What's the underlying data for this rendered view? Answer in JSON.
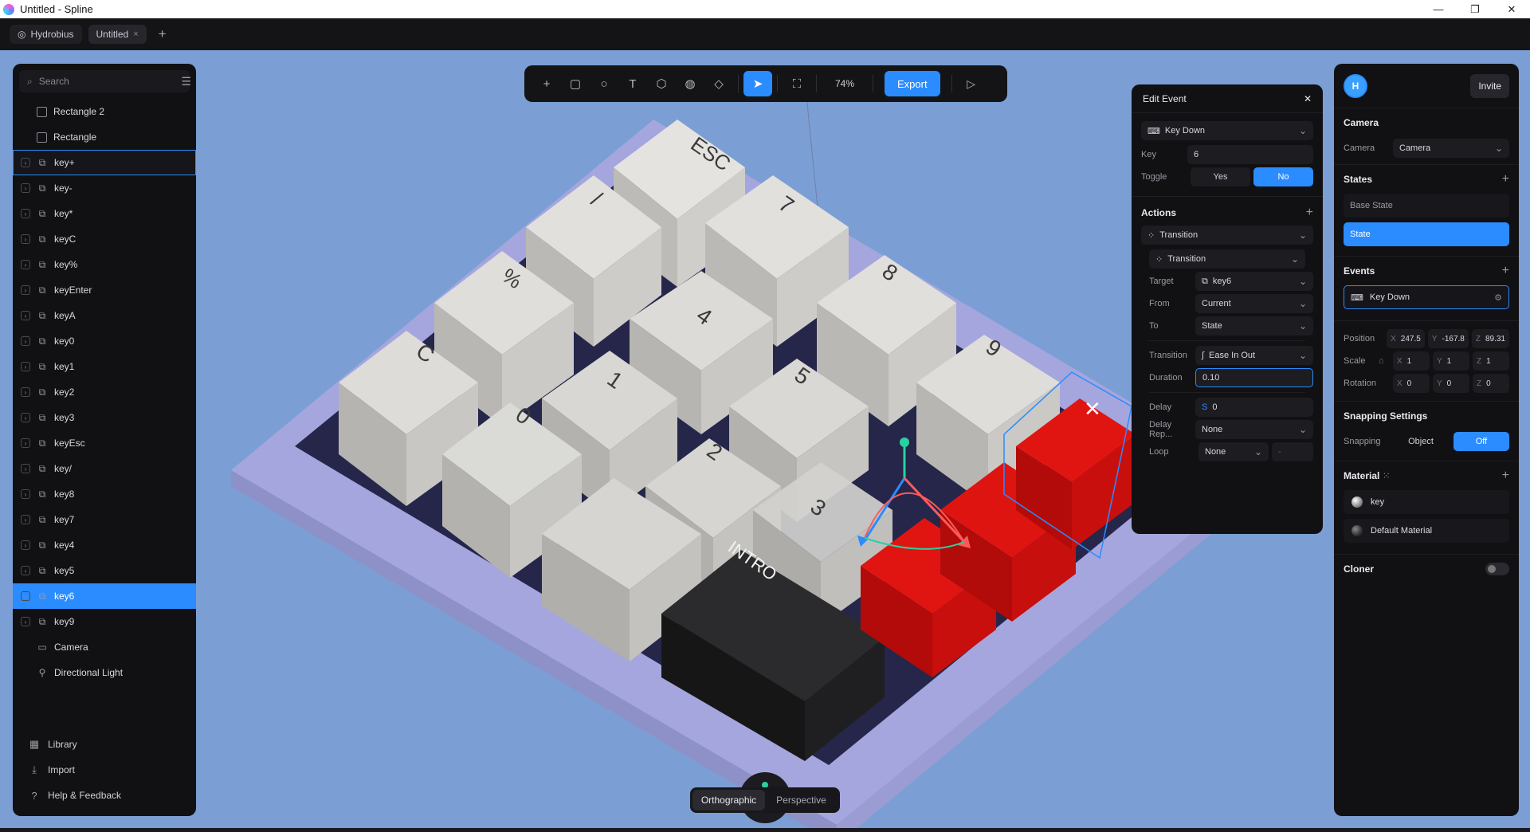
{
  "window": {
    "title": "Untitled - Spline",
    "minimize": "—",
    "maximize": "❐",
    "close": "✕"
  },
  "tabs": {
    "team": "Hydrobius",
    "file": "Untitled",
    "close": "×",
    "add": "+"
  },
  "sidebar": {
    "search_placeholder": "Search",
    "layers": [
      {
        "label": "Rectangle 2",
        "kind": "shape"
      },
      {
        "label": "Rectangle",
        "kind": "shape"
      },
      {
        "label": "key+",
        "kind": "group"
      },
      {
        "label": "key-",
        "kind": "group"
      },
      {
        "label": "key*",
        "kind": "group"
      },
      {
        "label": "keyC",
        "kind": "group"
      },
      {
        "label": "key%",
        "kind": "group"
      },
      {
        "label": "keyEnter",
        "kind": "group"
      },
      {
        "label": "keyA",
        "kind": "group"
      },
      {
        "label": "key0",
        "kind": "group"
      },
      {
        "label": "key1",
        "kind": "group"
      },
      {
        "label": "key2",
        "kind": "group"
      },
      {
        "label": "key3",
        "kind": "group"
      },
      {
        "label": "keyEsc",
        "kind": "group"
      },
      {
        "label": "key/",
        "kind": "group"
      },
      {
        "label": "key8",
        "kind": "group"
      },
      {
        "label": "key7",
        "kind": "group"
      },
      {
        "label": "key4",
        "kind": "group"
      },
      {
        "label": "key5",
        "kind": "group"
      },
      {
        "label": "key6",
        "kind": "group",
        "selected": true
      },
      {
        "label": "key9",
        "kind": "group"
      },
      {
        "label": "Camera",
        "kind": "camera"
      },
      {
        "label": "Directional Light",
        "kind": "light"
      }
    ],
    "footer": [
      "Library",
      "Import",
      "Help & Feedback"
    ]
  },
  "toolbar": {
    "zoom": "74%",
    "export": "Export"
  },
  "viewport": {
    "projection": [
      "Orthographic",
      "Perspective"
    ],
    "keys": {
      "esc": "ESC",
      "slash": "/",
      "seven": "7",
      "percent": "%",
      "four": "4",
      "eight": "8",
      "c": "C",
      "one": "1",
      "five": "5",
      "nine": "9",
      "zero": "0",
      "two": "2",
      "three": "3",
      "intro": "INTRO",
      "x": "✕"
    }
  },
  "edit_event": {
    "title": "Edit Event",
    "event_type": "Key Down",
    "key_label": "Key",
    "key_value": "6",
    "toggle_label": "Toggle",
    "toggle_yes": "Yes",
    "toggle_no": "No",
    "actions_title": "Actions",
    "action": "Transition",
    "sub_action": "Transition",
    "target_label": "Target",
    "target_value": "key6",
    "from_label": "From",
    "from_value": "Current",
    "to_label": "To",
    "to_value": "State",
    "transition_label": "Transition",
    "transition_value": "Ease In Out",
    "duration_label": "Duration",
    "duration_value": "0.10",
    "delay_label": "Delay",
    "delay_value": "0",
    "delay_rep_label": "Delay Rep...",
    "delay_rep_value": "None",
    "loop_label": "Loop",
    "loop_value": "None",
    "loop_extra": "-"
  },
  "props": {
    "avatar": "H",
    "invite": "Invite",
    "camera_title": "Camera",
    "camera_label": "Camera",
    "camera_value": "Camera",
    "states_title": "States",
    "base_state": "Base State",
    "state": "State",
    "events_title": "Events",
    "event": "Key Down",
    "position_label": "Position",
    "position": {
      "x": "247.5",
      "y": "-167.8",
      "z": "89.31"
    },
    "scale_label": "Scale",
    "scale": {
      "x": "1",
      "y": "1",
      "z": "1"
    },
    "rotation_label": "Rotation",
    "rotation": {
      "x": "0",
      "y": "0",
      "z": "0"
    },
    "snapping_title": "Snapping Settings",
    "snapping_label": "Snapping",
    "snap_object": "Object",
    "snap_off": "Off",
    "material_title": "Material",
    "materials": [
      "key",
      "Default Material"
    ],
    "cloner_title": "Cloner"
  }
}
